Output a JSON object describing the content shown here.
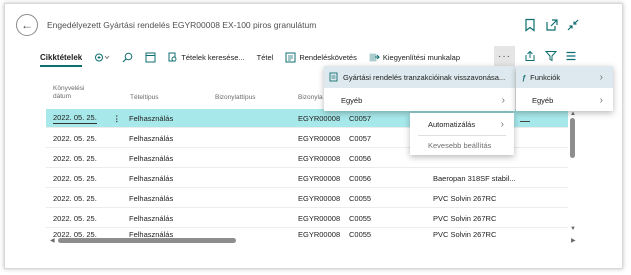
{
  "page": {
    "title": "Engedélyezett Gyártási rendelés EGYR00008 EX-100 piros granulátum"
  },
  "actionbar": {
    "lines_tab": "Cikktételek",
    "find_entries": "Tételek keresése...",
    "line_label": "Tétel",
    "order_tracking": "Rendeléskövetés",
    "worksheet": "Kiegyenlítési munkalap",
    "more": "···"
  },
  "columns": {
    "posting_date": "Könyvelési dátum",
    "entry_type": "Tételtípus",
    "doc_type": "Bizonylattípus",
    "doc_no": "Bizonyla"
  },
  "rows": [
    {
      "date": "2022. 05. 25.",
      "type": "Felhasználás",
      "doc": "EGYR00008",
      "item": "C0057",
      "desc": ""
    },
    {
      "date": "2022. 05. 25.",
      "type": "Felhasználás",
      "doc": "EGYR00008",
      "item": "C0057",
      "desc": ""
    },
    {
      "date": "2022. 05. 25.",
      "type": "Felhasználás",
      "doc": "EGYR00008",
      "item": "C0056",
      "desc": ""
    },
    {
      "date": "2022. 05. 25.",
      "type": "Felhasználás",
      "doc": "EGYR00008",
      "item": "C0056",
      "desc": "Baeropan 318SF stabil..."
    },
    {
      "date": "2022. 05. 25.",
      "type": "Felhasználás",
      "doc": "EGYR00008",
      "item": "C0055",
      "desc": "PVC Solvin 267RC"
    },
    {
      "date": "2022. 05. 25.",
      "type": "Felhasználás",
      "doc": "EGYR00008",
      "item": "C0055",
      "desc": "PVC Solvin 267RC"
    },
    {
      "date": "2022. 05. 25.",
      "type": "Felhasználás",
      "doc": "EGYR00008",
      "item": "C0055",
      "desc": "PVC Solvin 267RC"
    }
  ],
  "menu_main": {
    "item1": "Gyártási rendelés tranzakcióinak visszavonása...",
    "item2": "Egyéb"
  },
  "menu_right": {
    "item1": "Funkciók",
    "item2": "Egyéb"
  },
  "menu_sub": {
    "item1": "Automatizálás",
    "item2": "Kevesebb beállítás"
  },
  "colors": {
    "accent": "#0f6e70",
    "selected_row": "#a7e8ea"
  }
}
